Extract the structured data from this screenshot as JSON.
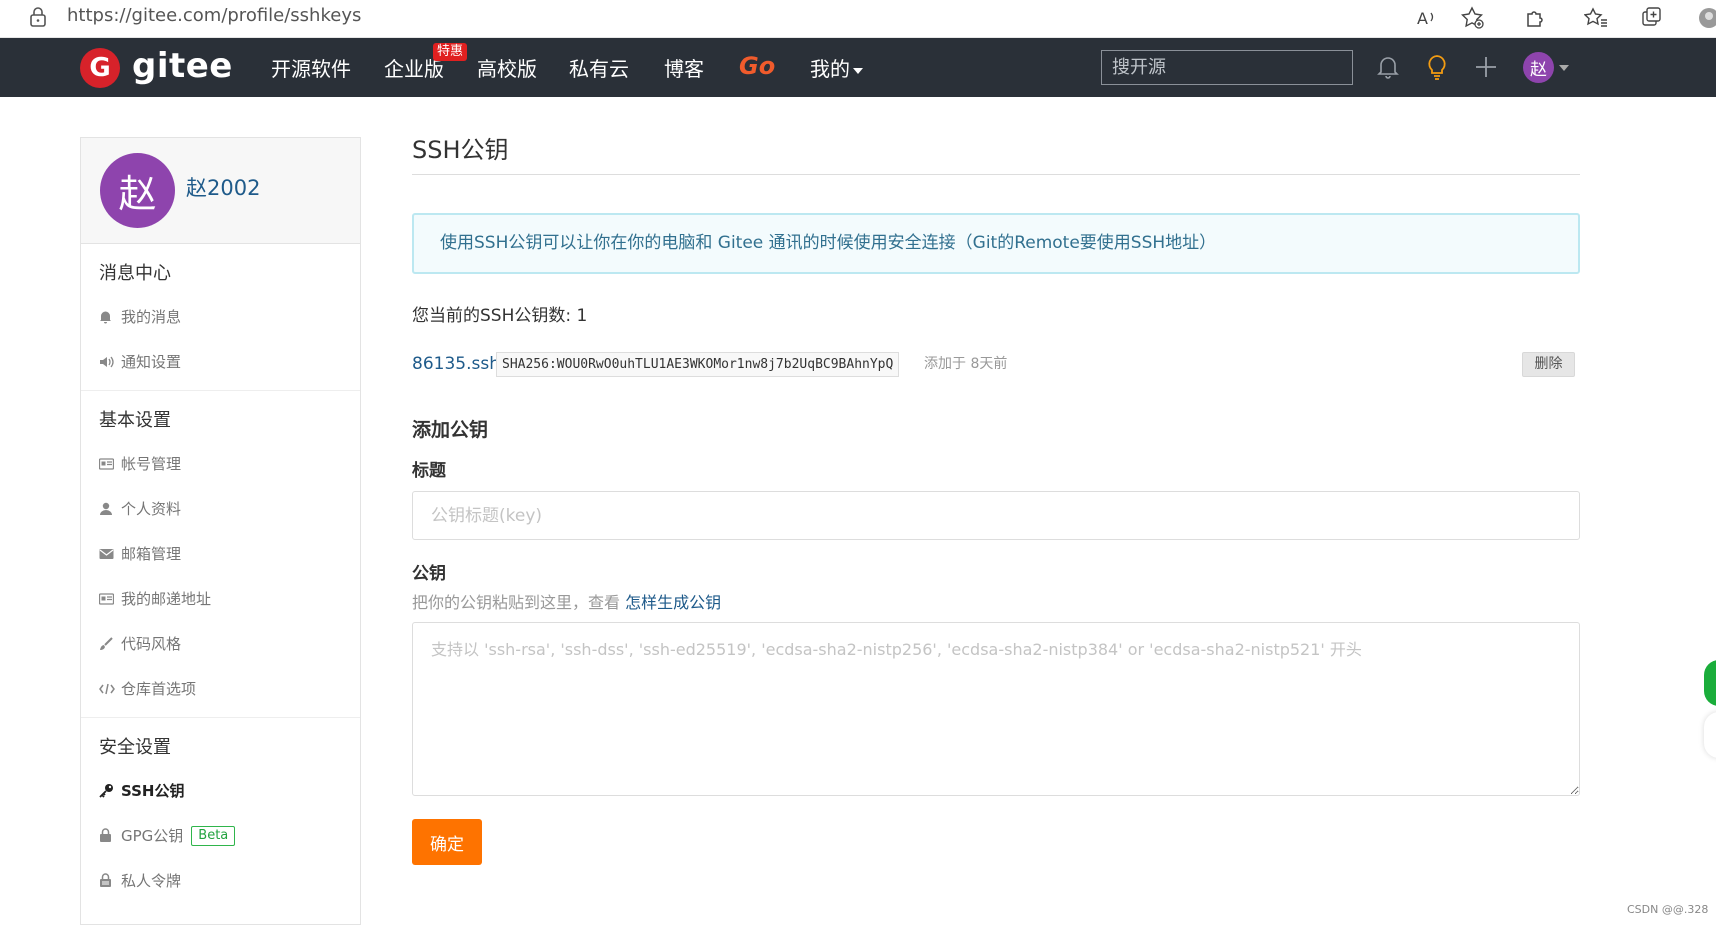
{
  "browser": {
    "url": "https://gitee.com/profile/sshkeys",
    "icons": [
      "lock-icon",
      "read-aloud-icon",
      "favorite-add-icon",
      "extensions-icon",
      "favorites-icon",
      "collections-icon",
      "profile-icon"
    ]
  },
  "navbar": {
    "logo_letter": "G",
    "logo_text": "gitee",
    "items": [
      "开源软件",
      "企业版",
      "高校版",
      "私有云",
      "博客",
      "Go",
      "我的"
    ],
    "hot_badge": "特惠",
    "search_placeholder": "搜开源",
    "avatar_char": "赵",
    "accent": "#f05b2c",
    "bg": "#2a3038"
  },
  "sidebar": {
    "avatar_char": "赵",
    "username": "赵2002",
    "sections": [
      {
        "title": "消息中心",
        "items": [
          "我的消息",
          "通知设置"
        ]
      },
      {
        "title": "基本设置",
        "items": [
          "帐号管理",
          "个人资料",
          "邮箱管理",
          "我的邮递地址",
          "代码风格",
          "仓库首选项"
        ]
      },
      {
        "title": "安全设置",
        "items": [
          "SSH公钥",
          "GPG公钥",
          "私人令牌"
        ],
        "gpg_badge": "Beta"
      }
    ]
  },
  "main": {
    "title": "SSH公钥",
    "info": "使用SSH公钥可以让你在你的电脑和 Gitee 通讯的时候使用安全连接（Git的Remote要使用SSH地址）",
    "key_count_label": "您当前的SSH公钥数: 1",
    "key": {
      "name": "86135.ssh",
      "fingerprint": "SHA256:WOU0RwO0uhTLU1AE3WKOMor1nw8j7b2UqBC9BAhnYpQ",
      "added": "添加于 8天前",
      "delete_label": "删除"
    },
    "add_title": "添加公钥",
    "title_label": "标题",
    "title_placeholder": "公钥标题(key)",
    "key_label": "公钥",
    "key_hint": "把你的公钥粘贴到这里，查看",
    "key_hint_link": "怎样生成公钥",
    "key_placeholder": "支持以 'ssh-rsa', 'ssh-dss', 'ssh-ed25519', 'ecdsa-sha2-nistp256', 'ecdsa-sha2-nistp384' or 'ecdsa-sha2-nistp521' 开头",
    "submit_label": "确定",
    "submit_color": "#fe7300"
  },
  "watermark": "CSDN @@.328"
}
